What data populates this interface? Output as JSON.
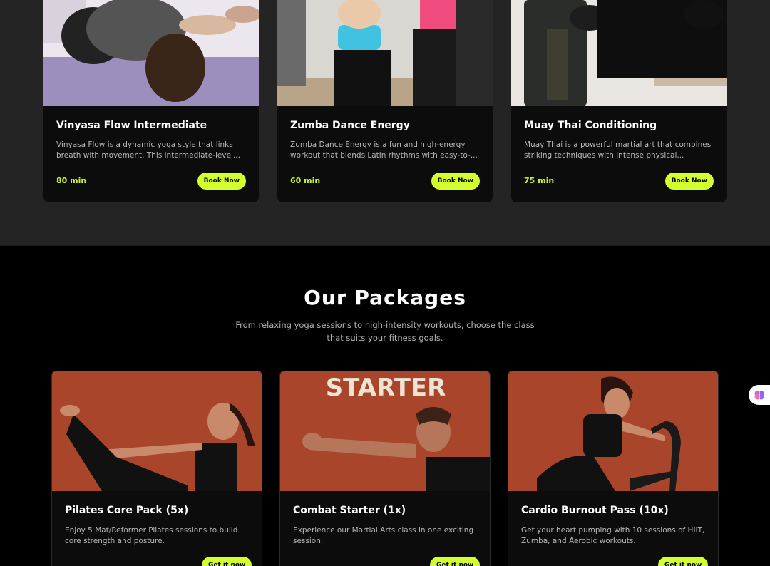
{
  "classes": [
    {
      "title": "Vinyasa Flow Intermediate",
      "description": "Vinyasa Flow is a dynamic yoga style that links breath with movement. This intermediate-level...",
      "duration": "80 min",
      "button": "Book Now",
      "image_icon": "yoga-photo"
    },
    {
      "title": "Zumba Dance Energy",
      "description": "Zumba Dance Energy is a fun and high-energy workout that blends Latin rhythms with easy-to-...",
      "duration": "60 min",
      "button": "Book Now",
      "image_icon": "zumba-photo"
    },
    {
      "title": "Muay Thai Conditioning",
      "description": "Muay Thai is a powerful martial art that combines striking techniques with intense physical...",
      "duration": "75 min",
      "button": "Book Now",
      "image_icon": "muay-thai-photo"
    }
  ],
  "packages": {
    "heading": "Our Packages",
    "subtitle": "From relaxing yoga sessions to high-intensity workouts, choose the class that suits your fitness goals.",
    "items": [
      {
        "title": "Pilates Core Pack (5x)",
        "description": "Enjoy 5 Mat/Reformer Pilates sessions to build core strength and posture.",
        "button": "Get it now",
        "image_icon": "pilates-photo"
      },
      {
        "title": "Combat Starter (1x)",
        "description": "Experience our Martial Arts class in one exciting session.",
        "button": "Get it now",
        "image_text": "STARTER",
        "image_icon": "boxing-photo"
      },
      {
        "title": "Cardio Burnout Pass (10x)",
        "description": "Get your heart pumping with 10 sessions of HIIT, Zumba, and Aerobic workouts.",
        "button": "Get it now",
        "image_icon": "cardio-photo"
      }
    ]
  },
  "colors": {
    "accent": "#d4ff2e",
    "duration": "#c6f52a",
    "section_bg": "#242424",
    "card_bg": "#0c0c0c",
    "package_photo_bg": "#a8452a"
  },
  "widget": {
    "icon": "brain-icon"
  }
}
